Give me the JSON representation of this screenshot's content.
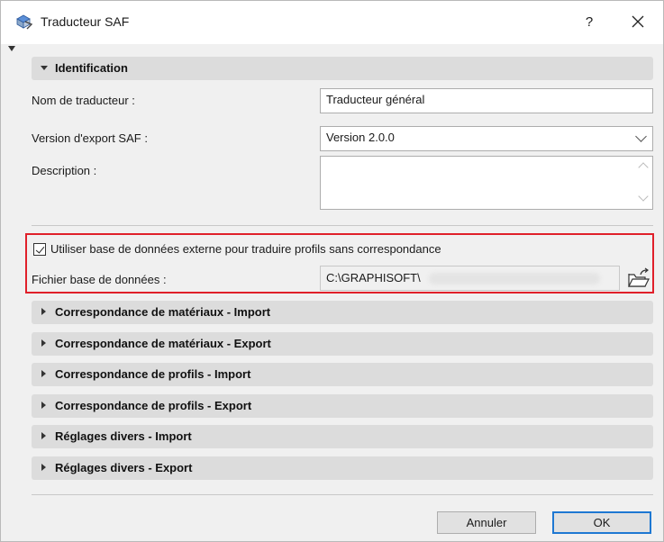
{
  "window": {
    "title": "Traducteur SAF",
    "help_label": "?",
    "close_label": "✕"
  },
  "identification": {
    "header": "Identification",
    "name_label": "Nom de traducteur :",
    "name_value": "Traducteur général",
    "version_label": "Version d'export SAF :",
    "version_value": "Version 2.0.0",
    "description_label": "Description :",
    "description_value": ""
  },
  "external_db": {
    "checked": true,
    "checkbox_label": "Utiliser base de données externe pour traduire profils sans correspondance",
    "file_label": "Fichier base de données :",
    "file_value": "C:\\GRAPHISOFT\\"
  },
  "sections": [
    {
      "label": "Correspondance de matériaux - Import"
    },
    {
      "label": "Correspondance de matériaux - Export"
    },
    {
      "label": "Correspondance de profils - Import"
    },
    {
      "label": "Correspondance de profils - Export"
    },
    {
      "label": "Réglages divers - Import"
    },
    {
      "label": "Réglages divers - Export"
    }
  ],
  "buttons": {
    "cancel": "Annuler",
    "ok": "OK"
  },
  "colors": {
    "highlight": "#e0202a",
    "ok_border": "#1e78d2"
  }
}
